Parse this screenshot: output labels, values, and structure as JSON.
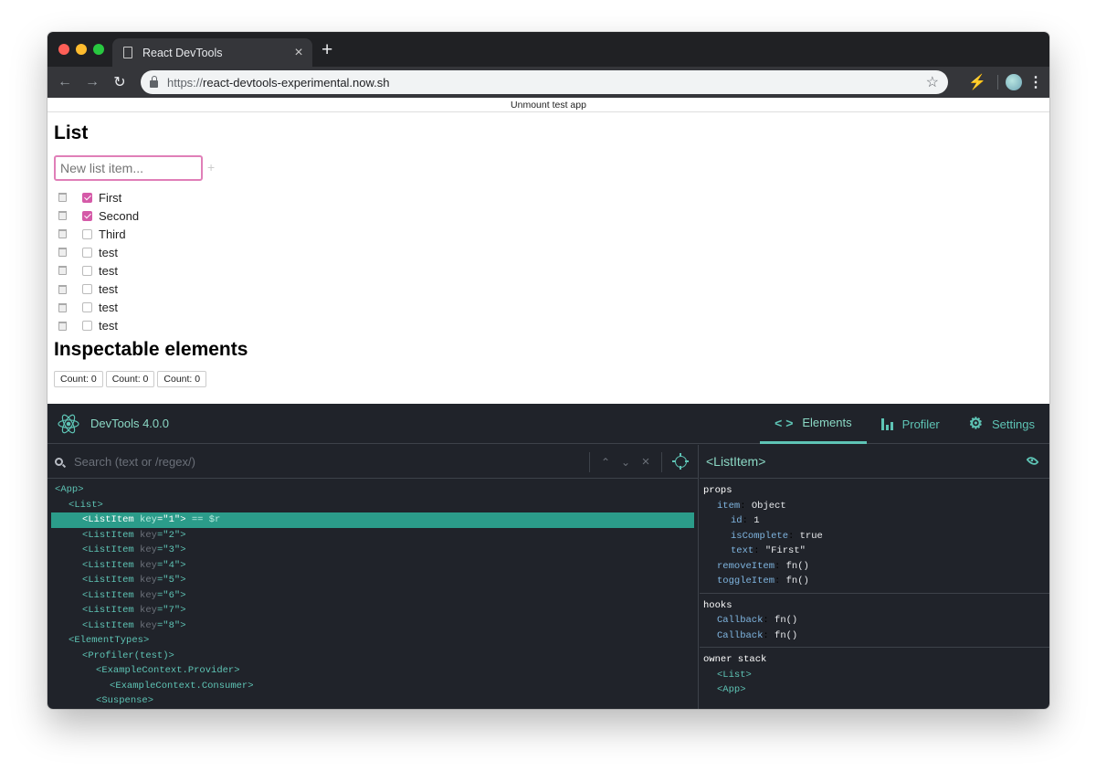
{
  "browser": {
    "tab_title": "React DevTools",
    "url_scheme": "https://",
    "url_host": "react-devtools-experimental.now.sh"
  },
  "app": {
    "unmount_label": "Unmount test app",
    "list_heading": "List",
    "new_item_placeholder": "New list item...",
    "add_symbol": "+",
    "items": [
      {
        "label": "First",
        "checked": true
      },
      {
        "label": "Second",
        "checked": true
      },
      {
        "label": "Third",
        "checked": false
      },
      {
        "label": "test",
        "checked": false
      },
      {
        "label": "test",
        "checked": false
      },
      {
        "label": "test",
        "checked": false
      },
      {
        "label": "test",
        "checked": false
      },
      {
        "label": "test",
        "checked": false
      }
    ],
    "inspect_heading": "Inspectable elements",
    "count_buttons": [
      "Count: 0",
      "Count: 0",
      "Count: 0"
    ]
  },
  "devtools": {
    "version": "DevTools 4.0.0",
    "tabs": {
      "elements": "Elements",
      "profiler": "Profiler",
      "settings": "Settings"
    },
    "search_placeholder": "Search (text or /regex/)",
    "tree": [
      {
        "depth": 0,
        "name": "App"
      },
      {
        "depth": 1,
        "name": "List"
      },
      {
        "depth": 2,
        "name": "ListItem",
        "key": "1",
        "selected": true,
        "suffix": " == $r"
      },
      {
        "depth": 2,
        "name": "ListItem",
        "key": "2"
      },
      {
        "depth": 2,
        "name": "ListItem",
        "key": "3"
      },
      {
        "depth": 2,
        "name": "ListItem",
        "key": "4"
      },
      {
        "depth": 2,
        "name": "ListItem",
        "key": "5"
      },
      {
        "depth": 2,
        "name": "ListItem",
        "key": "6"
      },
      {
        "depth": 2,
        "name": "ListItem",
        "key": "7"
      },
      {
        "depth": 2,
        "name": "ListItem",
        "key": "8"
      },
      {
        "depth": 1,
        "name": "ElementTypes"
      },
      {
        "depth": 2,
        "name": "Profiler(test)"
      },
      {
        "depth": 3,
        "name": "ExampleContext.Provider"
      },
      {
        "depth": 4,
        "name": "ExampleContext.Consumer"
      },
      {
        "depth": 3,
        "name": "Suspense"
      }
    ],
    "selected_component": "<ListItem>",
    "props_title": "props",
    "props": [
      {
        "depth": 1,
        "key": "item",
        "value": "Object"
      },
      {
        "depth": 2,
        "key": "id",
        "value": "1"
      },
      {
        "depth": 2,
        "key": "isComplete",
        "value": "true"
      },
      {
        "depth": 2,
        "key": "text",
        "value": "\"First\""
      },
      {
        "depth": 1,
        "key": "removeItem",
        "value": "fn()"
      },
      {
        "depth": 1,
        "key": "toggleItem",
        "value": "fn()"
      }
    ],
    "hooks_title": "hooks",
    "hooks": [
      {
        "depth": 1,
        "key": "Callback",
        "value": "fn()"
      },
      {
        "depth": 1,
        "key": "Callback",
        "value": "fn()"
      }
    ],
    "owner_title": "owner stack",
    "owners": [
      "<List>",
      "<App>"
    ]
  },
  "colors": {
    "devtools_bg": "#20232a",
    "accent": "#5ec4b5",
    "selection": "#2b9c8a",
    "checkbox_on": "#d55aa8"
  }
}
